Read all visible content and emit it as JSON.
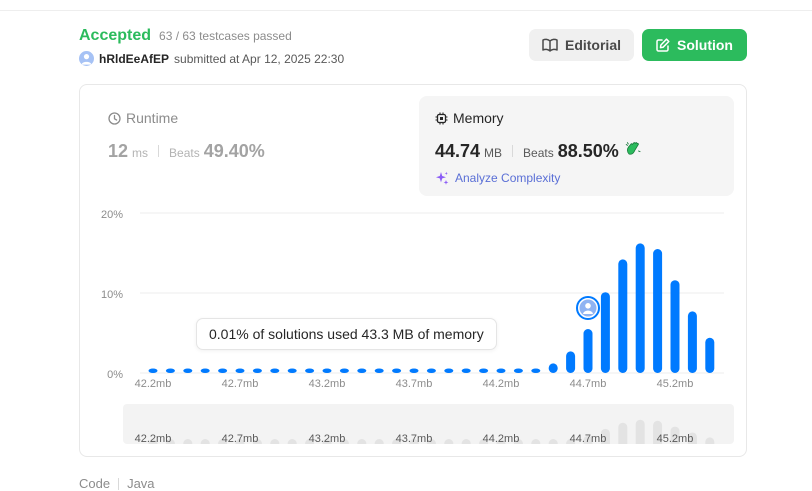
{
  "status": {
    "label": "Accepted",
    "testcases": "63 / 63 testcases passed"
  },
  "submission": {
    "username": "hRldEeAfEP",
    "submitted_text": "submitted at Apr 12, 2025 22:30"
  },
  "buttons": {
    "editorial_label": "Editorial",
    "solution_label": "Solution"
  },
  "runtime": {
    "title": "Runtime",
    "value": "12",
    "unit": "ms",
    "beats_label": "Beats",
    "beats_value": "49.40%"
  },
  "memory": {
    "title": "Memory",
    "value": "44.74",
    "unit": "MB",
    "beats_label": "Beats",
    "beats_value": "88.50%",
    "analyze_label": "Analyze Complexity"
  },
  "tooltip": {
    "text": "0.01% of solutions used 43.3 MB of memory"
  },
  "code": {
    "label": "Code",
    "language": "Java"
  },
  "colors": {
    "accent_green": "#2cbb5d",
    "bar_blue": "#007aff",
    "link_purple": "#5a6fd6"
  },
  "icons": {
    "editorial": "book-open-icon",
    "solution": "edit-icon",
    "runtime": "clock-icon",
    "memory": "chip-icon",
    "analyze": "sparkle-icon",
    "beats_badge": "clap-icon"
  },
  "chart_data": {
    "type": "bar",
    "ylabel": "",
    "xlabel": "",
    "yticks": [
      "20%",
      "10%",
      "0%"
    ],
    "ylim": [
      0,
      20
    ],
    "xticks": [
      "42.2mb",
      "42.7mb",
      "43.2mb",
      "43.7mb",
      "44.2mb",
      "44.7mb",
      "45.2mb"
    ],
    "x": [
      42.2,
      42.3,
      42.4,
      42.5,
      42.6,
      42.7,
      42.8,
      42.9,
      43.0,
      43.1,
      43.2,
      43.3,
      43.4,
      43.5,
      43.6,
      43.7,
      43.8,
      43.9,
      44.0,
      44.1,
      44.2,
      44.3,
      44.4,
      44.5,
      44.6,
      44.7,
      44.8,
      44.9,
      45.0,
      45.1,
      45.2,
      45.3,
      45.4
    ],
    "values": [
      0.1,
      0.1,
      0.1,
      0.1,
      0.1,
      0.1,
      0.1,
      0.1,
      0.1,
      0.1,
      0.1,
      0.1,
      0.1,
      0.1,
      0.1,
      0.1,
      0.1,
      0.1,
      0.1,
      0.1,
      0.1,
      0.1,
      0.3,
      1.2,
      2.7,
      5.5,
      10.1,
      14.2,
      16.2,
      15.5,
      11.6,
      7.7,
      4.4
    ],
    "highlight_x": 44.7,
    "grid": true
  }
}
